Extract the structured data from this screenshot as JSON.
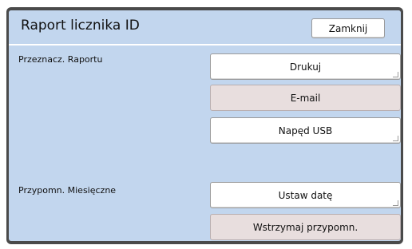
{
  "header": {
    "title": "Raport licznika ID",
    "close_label": "Zamknij"
  },
  "report_destination": {
    "label": "Przeznacz. Raportu",
    "options": [
      {
        "label": "Drukuj",
        "enabled": true
      },
      {
        "label": "E-mail",
        "enabled": false
      },
      {
        "label": "Napęd USB",
        "enabled": true
      }
    ]
  },
  "monthly_reminder": {
    "label": "Przypomn. Miesięczne",
    "set_date_label": "Ustaw datę",
    "suspend_label": "Wstrzymaj przypomn."
  }
}
